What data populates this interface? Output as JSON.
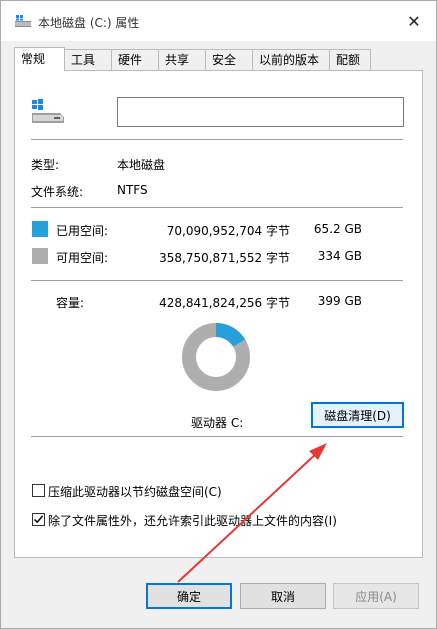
{
  "window": {
    "title": "本地磁盘 (C:) 属性",
    "close_glyph": "✕"
  },
  "tabs": [
    {
      "label": "常规",
      "active": true
    },
    {
      "label": "工具"
    },
    {
      "label": "硬件"
    },
    {
      "label": "共享"
    },
    {
      "label": "安全"
    },
    {
      "label": "以前的版本"
    },
    {
      "label": "配额"
    }
  ],
  "general": {
    "volume_name": "",
    "type_label": "类型:",
    "type_value": "本地磁盘",
    "fs_label": "文件系统:",
    "fs_value": "NTFS",
    "used": {
      "label": "已用空间:",
      "bytes": "70,090,952,704 字节",
      "size": "65.2 GB",
      "color": "#26a0da"
    },
    "free": {
      "label": "可用空间:",
      "bytes": "358,750,871,552 字节",
      "size": "334 GB",
      "color": "#aeaeae"
    },
    "capacity": {
      "label": "容量:",
      "bytes": "428,841,824,256 字节",
      "size": "399 GB"
    },
    "used_fraction": 0.1634,
    "drive_label": "驱动器 C:",
    "cleanup_button": "磁盘清理(D)",
    "compress_label": "压缩此驱动器以节约磁盘空间(C)",
    "compress_checked": false,
    "index_label": "除了文件属性外，还允许索引此驱动器上文件的内容(I)",
    "index_checked": true
  },
  "buttons": {
    "ok": "确定",
    "cancel": "取消",
    "apply": "应用(A)"
  },
  "colors": {
    "accent": "#0078d7",
    "annotation_arrow": "#e53935"
  }
}
